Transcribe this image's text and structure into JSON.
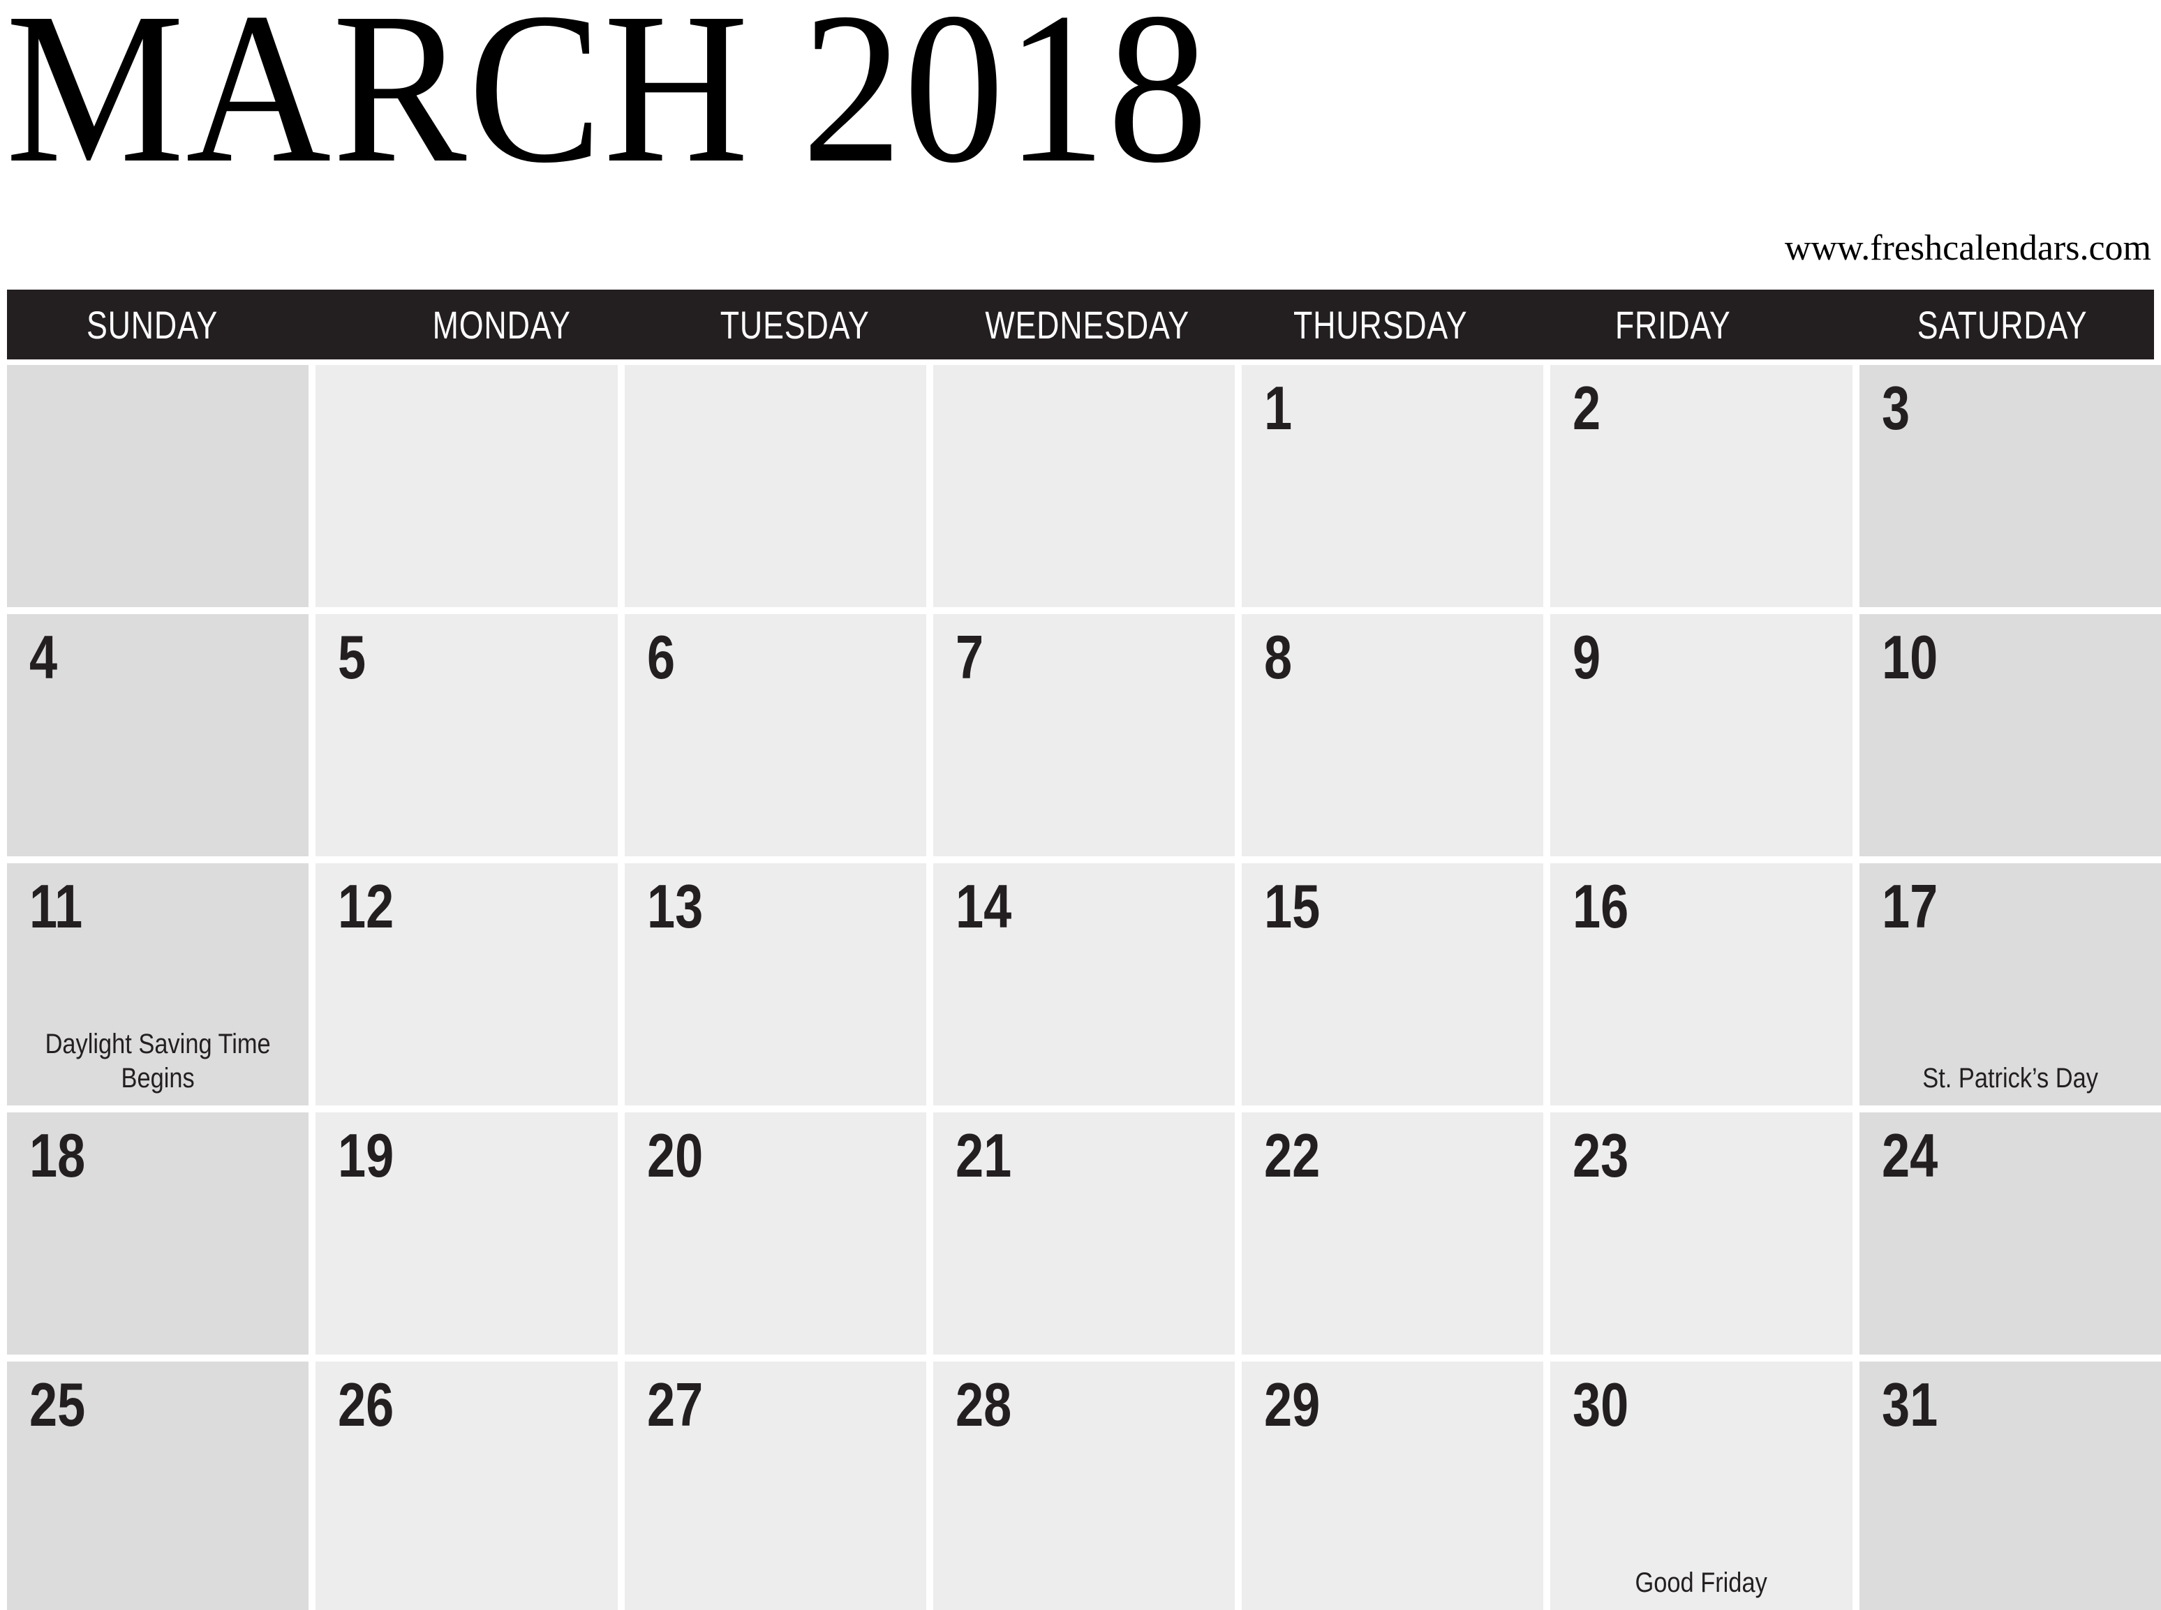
{
  "header": {
    "month_year": "MARCH 2018",
    "site_url": "www.freshcalendars.com"
  },
  "colors": {
    "header_bar": "#231F20",
    "weekend_cell": "#DCDCDC",
    "weekday_cell": "#EDEDED",
    "text": "#231F20",
    "page_background": "#FFFFFF"
  },
  "weekdays": [
    {
      "label": "SUNDAY"
    },
    {
      "label": "MONDAY"
    },
    {
      "label": "TUESDAY"
    },
    {
      "label": "WEDNESDAY"
    },
    {
      "label": "THURSDAY"
    },
    {
      "label": "FRIDAY"
    },
    {
      "label": "SATURDAY"
    }
  ],
  "weeks": [
    [
      {
        "day": "",
        "event": ""
      },
      {
        "day": "",
        "event": ""
      },
      {
        "day": "",
        "event": ""
      },
      {
        "day": "",
        "event": ""
      },
      {
        "day": "1",
        "event": ""
      },
      {
        "day": "2",
        "event": ""
      },
      {
        "day": "3",
        "event": ""
      }
    ],
    [
      {
        "day": "4",
        "event": ""
      },
      {
        "day": "5",
        "event": ""
      },
      {
        "day": "6",
        "event": ""
      },
      {
        "day": "7",
        "event": ""
      },
      {
        "day": "8",
        "event": ""
      },
      {
        "day": "9",
        "event": ""
      },
      {
        "day": "10",
        "event": ""
      }
    ],
    [
      {
        "day": "11",
        "event": "Daylight Saving Time Begins"
      },
      {
        "day": "12",
        "event": ""
      },
      {
        "day": "13",
        "event": ""
      },
      {
        "day": "14",
        "event": ""
      },
      {
        "day": "15",
        "event": ""
      },
      {
        "day": "16",
        "event": ""
      },
      {
        "day": "17",
        "event": "St. Patrick’s Day"
      }
    ],
    [
      {
        "day": "18",
        "event": ""
      },
      {
        "day": "19",
        "event": ""
      },
      {
        "day": "20",
        "event": ""
      },
      {
        "day": "21",
        "event": ""
      },
      {
        "day": "22",
        "event": ""
      },
      {
        "day": "23",
        "event": ""
      },
      {
        "day": "24",
        "event": ""
      }
    ],
    [
      {
        "day": "25",
        "event": ""
      },
      {
        "day": "26",
        "event": ""
      },
      {
        "day": "27",
        "event": ""
      },
      {
        "day": "28",
        "event": ""
      },
      {
        "day": "29",
        "event": ""
      },
      {
        "day": "30",
        "event": "Good Friday"
      },
      {
        "day": "31",
        "event": ""
      }
    ]
  ]
}
